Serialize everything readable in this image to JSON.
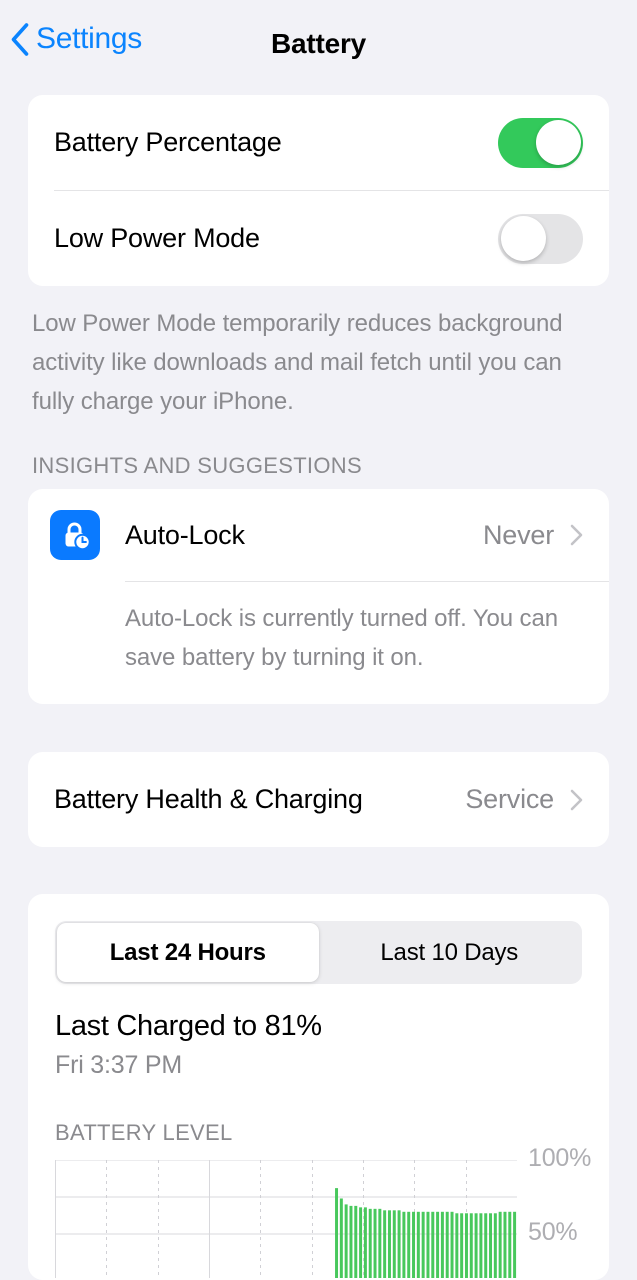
{
  "nav": {
    "back_label": "Settings",
    "back_icon": "chevron-left-icon",
    "title": "Battery"
  },
  "settings_group": {
    "rows": [
      {
        "label": "Battery Percentage",
        "toggle": "on"
      },
      {
        "label": "Low Power Mode",
        "toggle": "off"
      }
    ],
    "footer": "Low Power Mode temporarily reduces background activity like downloads and mail fetch until you can fully charge your iPhone."
  },
  "insights": {
    "header": "INSIGHTS AND SUGGESTIONS",
    "autolock": {
      "icon": "lock-clock-icon",
      "icon_color": "#0A7AFF",
      "label": "Auto-Lock",
      "value": "Never",
      "chevron": "chevron-right-icon",
      "description": "Auto-Lock is currently turned off. You can save battery by turning it on."
    }
  },
  "battery_health": {
    "label": "Battery Health & Charging",
    "value": "Service",
    "chevron": "chevron-right-icon"
  },
  "usage": {
    "segments": [
      {
        "label": "Last 24 Hours",
        "selected": true
      },
      {
        "label": "Last 10 Days",
        "selected": false
      }
    ],
    "last_charged_title": "Last Charged to 81%",
    "last_charged_time": "Fri 3:37 PM"
  },
  "chart_data": {
    "type": "bar",
    "title": "BATTERY LEVEL",
    "xlabel": "",
    "ylabel": "",
    "ylim": [
      0,
      100
    ],
    "ytick_labels": [
      "100%",
      "50%"
    ],
    "yticks": [
      100,
      50
    ],
    "grid": true,
    "grid_style": "dashed-vertical-solid-horizontal",
    "bar_color": "#48C85C",
    "legend": "none",
    "x_slots": 96,
    "first_bar_slot": 58,
    "values": [
      81,
      74,
      70,
      69,
      69,
      68,
      68,
      67,
      67,
      67,
      66,
      66,
      66,
      66,
      65,
      65,
      65,
      65,
      65,
      65,
      65,
      65,
      65,
      65,
      65,
      64,
      64,
      64,
      64,
      64,
      64,
      64,
      64,
      64,
      65,
      65,
      65,
      65,
      64,
      64,
      64,
      64,
      64,
      63,
      63,
      62,
      61,
      61,
      61,
      61,
      61,
      61,
      61,
      60,
      60,
      60,
      60,
      59,
      59,
      58,
      58,
      58,
      58,
      57
    ]
  },
  "colors": {
    "accent_blue": "#0B84FE",
    "toggle_on_green": "#33C95B",
    "toggle_off_gray": "#E4E4E6",
    "chart_green": "#48C85C",
    "secondary_text": "#8A8A8E",
    "page_background": "#F2F2F7",
    "card_background": "#FFFFFF"
  }
}
